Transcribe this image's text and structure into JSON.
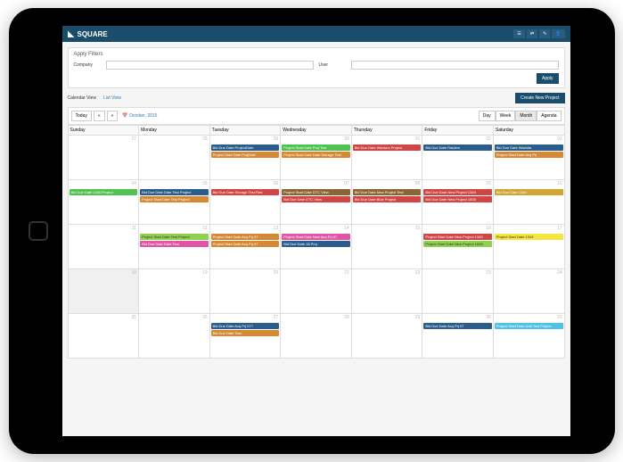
{
  "logo": "SQUARE",
  "filters": {
    "title": "Apply Filters",
    "company_label": "Company",
    "user_label": "User",
    "apply_label": "Apply"
  },
  "views": {
    "calendar": "Calendar View",
    "list": "List View",
    "create": "Create New Project"
  },
  "toolbar": {
    "today": "Today",
    "prev": "«",
    "next": "»",
    "date": "October, 2015",
    "day": "Day",
    "week": "Week",
    "month": "Month",
    "agenda": "Agenda"
  },
  "days": [
    "Sunday",
    "Monday",
    "Tuesday",
    "Wednesday",
    "Thursday",
    "Friday",
    "Saturday"
  ],
  "weeks": [
    [
      {
        "n": "27",
        "ev": []
      },
      {
        "n": "28",
        "ev": []
      },
      {
        "n": "29",
        "ev": [
          {
            "t": "Bid Due Date ProjectDate",
            "c": "c-blue"
          },
          {
            "t": "Project Start Date ProjDate",
            "c": "c-orange"
          }
        ]
      },
      {
        "n": "30",
        "ev": [
          {
            "t": "Project Start Date Proj Test",
            "c": "c-green"
          },
          {
            "t": "Project Start Date Date Storage Test",
            "c": "c-orange"
          }
        ]
      },
      {
        "n": "01",
        "ev": [
          {
            "t": "Bid Due Date Warriors Project",
            "c": "c-red"
          }
        ]
      },
      {
        "n": "02",
        "ev": [
          {
            "t": "Bid Due Date Raiders",
            "c": "c-blue"
          }
        ]
      },
      {
        "n": "03",
        "ev": [
          {
            "t": "Bid Due Date Washita",
            "c": "c-blue"
          },
          {
            "t": "Project Start Date Acq Prj",
            "c": "c-orange"
          }
        ]
      }
    ],
    [
      {
        "n": "04",
        "ev": [
          {
            "t": "Bid Due Date 1000 Project",
            "c": "c-green"
          }
        ]
      },
      {
        "n": "05",
        "ev": [
          {
            "t": "Bid Due Date Date Test Project",
            "c": "c-blue"
          },
          {
            "t": "Project Start Date Test Project",
            "c": "c-orange"
          }
        ]
      },
      {
        "n": "06",
        "ev": [
          {
            "t": "Bid Due Date Storage Test Red",
            "c": "c-red"
          }
        ]
      },
      {
        "n": "07",
        "ev": [
          {
            "t": "Project Start Date DTC View",
            "c": "c-brown"
          },
          {
            "t": "Bid Due Date DTC View",
            "c": "c-red"
          }
        ]
      },
      {
        "n": "08",
        "ev": [
          {
            "t": "Bid Due Date New Project Test",
            "c": "c-brown"
          },
          {
            "t": "Bid Due Date Blue Project",
            "c": "c-red"
          }
        ]
      },
      {
        "n": "09",
        "ev": [
          {
            "t": "Bid Due Date New Project 1349",
            "c": "c-red"
          },
          {
            "t": "Bid Due Date New Project 1608",
            "c": "c-red"
          }
        ]
      },
      {
        "n": "10",
        "ev": [
          {
            "t": "Bid Due Date 1346",
            "c": "c-gold"
          }
        ]
      }
    ],
    [
      {
        "n": "11",
        "ev": []
      },
      {
        "n": "12",
        "ev": [
          {
            "t": "Project Start Date Test Project",
            "c": "c-lime"
          },
          {
            "t": "Bid Due Date Date Test",
            "c": "c-pink"
          }
        ]
      },
      {
        "n": "13",
        "ev": [
          {
            "t": "Project Start Date Acq Prj 07",
            "c": "c-orange"
          },
          {
            "t": "Project Start Date Acq Prj 07",
            "c": "c-orange"
          }
        ]
      },
      {
        "n": "14",
        "ev": [
          {
            "t": "Project Start Date New Acq Prj 07",
            "c": "c-pink"
          },
          {
            "t": "Bid Due Date JA Proj",
            "c": "c-blue"
          }
        ]
      },
      {
        "n": "15",
        "ev": []
      },
      {
        "n": "16",
        "ev": [
          {
            "t": "Project Start Date New Project 1349",
            "c": "c-red"
          },
          {
            "t": "Project Start Date New Project 1608",
            "c": "c-lime"
          }
        ]
      },
      {
        "n": "17",
        "ev": [
          {
            "t": "Project Start Date 1343",
            "c": "c-yellow"
          }
        ]
      }
    ],
    [
      {
        "n": "18",
        "today": true,
        "ev": []
      },
      {
        "n": "19",
        "ev": []
      },
      {
        "n": "20",
        "ev": []
      },
      {
        "n": "21",
        "ev": []
      },
      {
        "n": "22",
        "ev": []
      },
      {
        "n": "23",
        "ev": []
      },
      {
        "n": "24",
        "ev": []
      }
    ],
    [
      {
        "n": "25",
        "ev": []
      },
      {
        "n": "26",
        "ev": []
      },
      {
        "n": "27",
        "ev": [
          {
            "t": "Bid Due Date Acq Prj 07?",
            "c": "c-blue"
          },
          {
            "t": "Bid Due Date Test",
            "c": "c-orange"
          }
        ]
      },
      {
        "n": "28",
        "ev": []
      },
      {
        "n": "29",
        "ev": []
      },
      {
        "n": "30",
        "ev": [
          {
            "t": "Bid Due Date Acq Prj 07",
            "c": "c-blue"
          }
        ]
      },
      {
        "n": "31",
        "ev": [
          {
            "t": "Project Start Date Unit Test Project",
            "c": "c-cyan"
          }
        ]
      }
    ]
  ]
}
